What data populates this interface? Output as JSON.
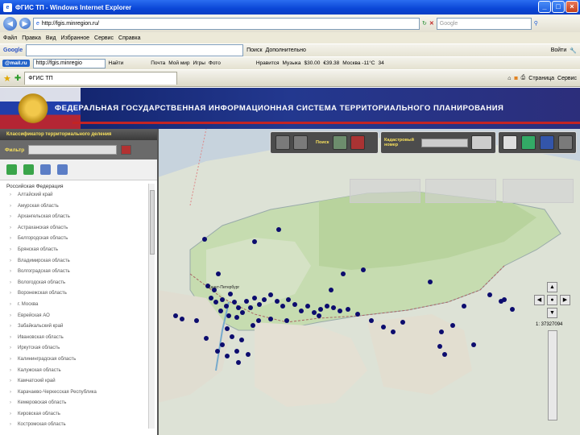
{
  "window": {
    "title": "ФГИС ТП - Windows Internet Explorer"
  },
  "address": {
    "url": "http://fgis.minregion.ru/",
    "search_placeholder": "Google"
  },
  "menu": [
    "Файл",
    "Правка",
    "Вид",
    "Избранное",
    "Сервис",
    "Справка"
  ],
  "google_bar": {
    "label": "Google",
    "search_button": "Поиск",
    "more": "Дополнительно",
    "login": "Войти"
  },
  "mail_bar": {
    "logo": "@mail.ru",
    "url": "http://fgis.minregio",
    "find": "Найти",
    "items": [
      "Почта",
      "Мой мир",
      "Игры",
      "Фото",
      "Нравится",
      "Музыка",
      "$30.00",
      "€39.38",
      "Москва -11°C",
      "34"
    ]
  },
  "tab": {
    "label": "ФГИС ТП",
    "page": "Страница",
    "service": "Сервис"
  },
  "banner": {
    "title": "ФЕДЕРАЛЬНАЯ ГОСУДАРСТВЕННАЯ ИНФОРМАЦИОННАЯ СИСТЕМА ТЕРРИТОРИАЛЬНОГО ПЛАНИРОВАНИЯ"
  },
  "panel": {
    "header": "Классификатор территориального деления",
    "filter_label": "Фильтр",
    "root": "Российская Федерация",
    "regions": [
      "Алтайский край",
      "Амурская область",
      "Архангельская область",
      "Астраханская область",
      "Белгородская область",
      "Брянская область",
      "Владимирская область",
      "Волгоградская область",
      "Вологодская область",
      "Воронежская область",
      "г. Москва",
      "Еврейская АО",
      "Забайкальский край",
      "Ивановская область",
      "Иркутская область",
      "Калининградская область",
      "Калужская область",
      "Камчатский край",
      "Карачаево-Черкесская Республика",
      "Кемеровская область",
      "Кировская область",
      "Костромская область"
    ]
  },
  "map": {
    "toolbar_label_1": "Поиск",
    "toolbar_label_2": "Кадастровый номер",
    "city_label": "Санкт-Петербург",
    "coords": "1: 37327094"
  }
}
